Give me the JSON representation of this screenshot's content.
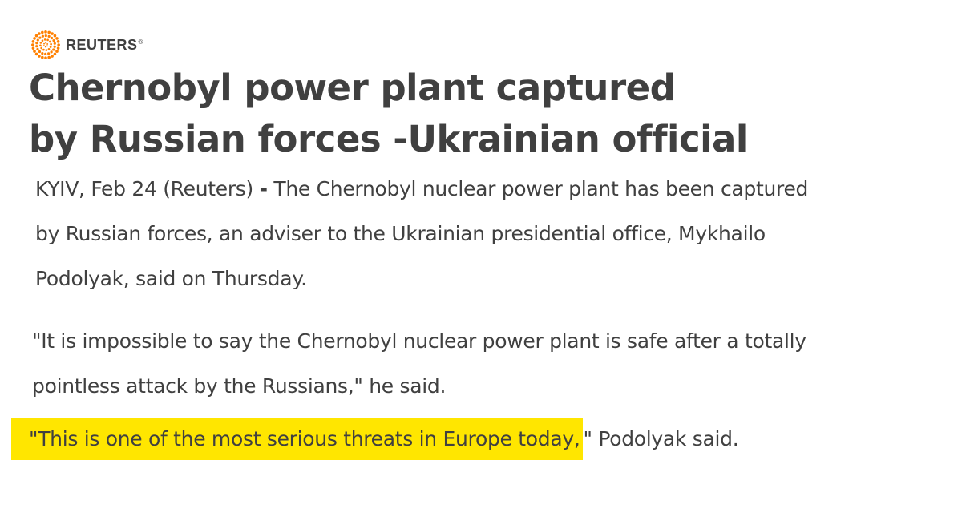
{
  "brand": {
    "name": "REUTERS",
    "mark": "®",
    "accent_color": "#ff8000"
  },
  "headline": {
    "line1": "Chernobyl power plant captured",
    "line2": "by Russian forces -Ukrainian official"
  },
  "article": {
    "p1": {
      "dateline": "KYIV, Feb 24 (Reuters)",
      "dash": "-",
      "line1_rest": "The Chernobyl nuclear power plant has been captured",
      "line2": "by Russian forces, an adviser to the Ukrainian presidential office, Mykhailo",
      "line3": "Podolyak, said on Thursday."
    },
    "p2": {
      "line1": "\"It is impossible to say the Chernobyl nuclear power plant is safe after a totally",
      "line2": "pointless attack by the Russians,\" he said."
    },
    "p3": {
      "highlighted": "\"This is one of the most serious threats in Europe today,",
      "rest": "\" Podolyak said."
    }
  },
  "highlight_color": "#ffe600"
}
